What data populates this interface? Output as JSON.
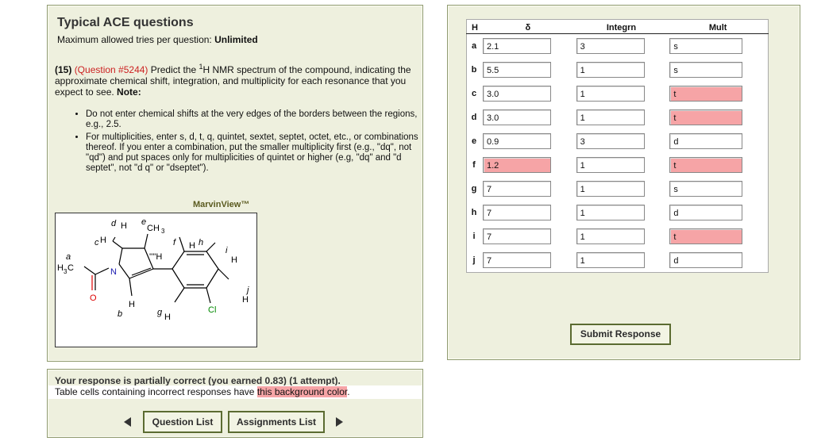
{
  "left": {
    "title": "Typical ACE questions",
    "tries_label": "Maximum allowed tries per question: ",
    "tries_value": "Unlimited",
    "q_num": "(15)",
    "q_id": "(Question #5244)",
    "q_text1": " Predict the ",
    "q_sup": "1",
    "q_text2": "H NMR spectrum of the compound, indicating the approximate chemical shift, integration, and multiplicity for each resonance that you expect to see. ",
    "q_note": "Note:",
    "bullets": [
      "Do not enter chemical shifts at the very edges of the borders between the regions, e.g., 2.5.",
      "For multiplicities, enter s, d, t, q, quintet, sextet, septet, octet, etc., or combinations thereof. If you enter a combination, put the smaller multiplicity first (e.g., \"dq\", not \"qd\") and put spaces only for multiplicities of quintet or higher (e.g, \"dq\" and \"d septet\", not \"d q\" or \"dseptet\")."
    ],
    "viewer_label": "MarvinView™"
  },
  "molecule": {
    "labels": {
      "d": "d",
      "e": "e",
      "c": "c",
      "f": "f",
      "h": "h",
      "i": "i",
      "a": "a",
      "j": "j",
      "b": "b",
      "g": "g",
      "H": "H",
      "CH": "CH",
      "three": "3",
      "H3C_H": "H",
      "H3C_3": "3",
      "H3C_C": "C",
      "N": "N",
      "O": "O",
      "Cl": "Cl",
      "hash_H": "''''H"
    }
  },
  "table": {
    "headers": [
      "H",
      "δ",
      "Integrn",
      "Mult"
    ],
    "rows": [
      {
        "label": "a",
        "shift": "2.1",
        "integ": "3",
        "mult": "s"
      },
      {
        "label": "b",
        "shift": "5.5",
        "integ": "1",
        "mult": "s"
      },
      {
        "label": "c",
        "shift": "3.0",
        "integ": "1",
        "mult": "t"
      },
      {
        "label": "d",
        "shift": "3.0",
        "integ": "1",
        "mult": "t"
      },
      {
        "label": "e",
        "shift": "0.9",
        "integ": "3",
        "mult": "d"
      },
      {
        "label": "f",
        "shift": "1.2",
        "integ": "1",
        "mult": "t"
      },
      {
        "label": "g",
        "shift": "7",
        "integ": "1",
        "mult": "s"
      },
      {
        "label": "h",
        "shift": "7",
        "integ": "1",
        "mult": "d"
      },
      {
        "label": "i",
        "shift": "7",
        "integ": "1",
        "mult": "t"
      },
      {
        "label": "j",
        "shift": "7",
        "integ": "1",
        "mult": "d"
      }
    ],
    "wrong_cells": {
      "c": [
        "mult"
      ],
      "d": [
        "mult"
      ],
      "f": [
        "shift",
        "mult"
      ],
      "i": [
        "mult"
      ]
    },
    "submit_label": "Submit Response"
  },
  "feedback": {
    "line1": "Your response is partially correct (you earned 0.83) (1 attempt).",
    "line2_pre": "Table cells containing incorrect responses have ",
    "line2_highlight": "this background color",
    "line2_post": ".",
    "question_list_label": "Question List",
    "assignments_label": "Assignments List"
  },
  "colors": {
    "incorrect": "#f6a4a6",
    "panel": "#eef0de",
    "border": "#5b6b31",
    "question_id": "#cc2222",
    "oxygen": "#dd0000",
    "chlorine": "#008800"
  }
}
